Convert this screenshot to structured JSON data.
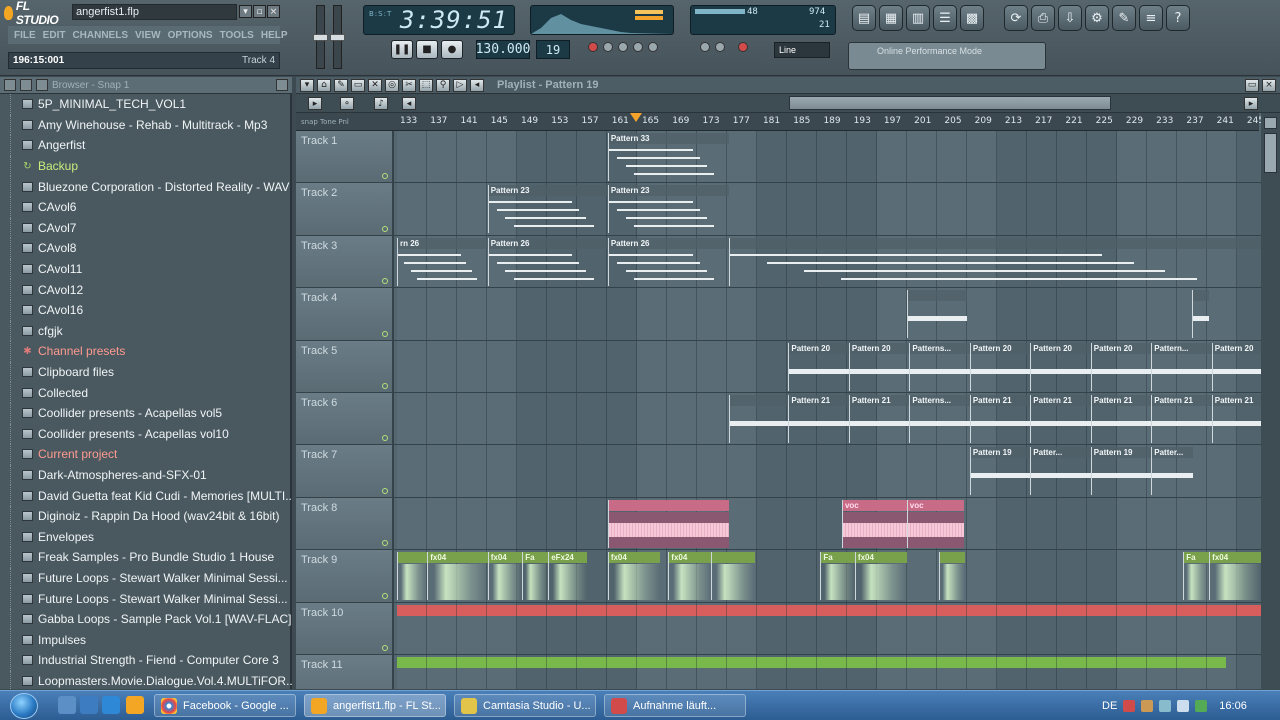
{
  "app": {
    "name": "FL STUDIO",
    "filename": "angerfist1.flp",
    "menu": [
      "FILE",
      "EDIT",
      "CHANNELS",
      "VIEW",
      "OPTIONS",
      "TOOLS",
      "HELP"
    ],
    "hint_position": "196:15:001",
    "hint_track": "Track 4",
    "clock": "3:39:51",
    "clock_unit": "B:S:T",
    "tempo": "130.000",
    "pattern_num": "19",
    "snap": "Line",
    "cpu_mem": "48",
    "cpu_poly": "974",
    "cpu_small": "21",
    "hint_box": "Online Performance Mode"
  },
  "colors": {
    "accent": "#f4a32b",
    "clip_pink": "#c86b87",
    "clip_green": "#79a04a",
    "auto_red": "#d85e5e",
    "auto_green": "#79b94c"
  },
  "browser": {
    "title": "Browser - Snap 1",
    "items": [
      {
        "label": "5P_MINIMAL_TECH_VOL1",
        "type": "folder"
      },
      {
        "label": "Amy Winehouse - Rehab - Multitrack - Mp3",
        "type": "folder"
      },
      {
        "label": "Angerfist",
        "type": "folder"
      },
      {
        "label": "Backup",
        "type": "special-green"
      },
      {
        "label": "Bluezone Corporation - Distorted Reality - WAV",
        "type": "folder"
      },
      {
        "label": "CAvol6",
        "type": "folder"
      },
      {
        "label": "CAvol7",
        "type": "folder"
      },
      {
        "label": "CAvol8",
        "type": "folder"
      },
      {
        "label": "CAvol11",
        "type": "folder"
      },
      {
        "label": "CAvol12",
        "type": "folder"
      },
      {
        "label": "CAvol16",
        "type": "folder"
      },
      {
        "label": "cfgjk",
        "type": "folder"
      },
      {
        "label": "Channel presets",
        "type": "special-red"
      },
      {
        "label": "Clipboard files",
        "type": "folder"
      },
      {
        "label": "Collected",
        "type": "folder"
      },
      {
        "label": "Coollider presents - Acapellas vol5",
        "type": "folder"
      },
      {
        "label": "Coollider presents - Acapellas vol10",
        "type": "folder"
      },
      {
        "label": "Current project",
        "type": "special-red"
      },
      {
        "label": "Dark-Atmospheres-and-SFX-01",
        "type": "folder"
      },
      {
        "label": "David Guetta feat Kid Cudi - Memories [MULTI...",
        "type": "folder"
      },
      {
        "label": "Diginoiz - Rappin Da Hood (wav24bit & 16bit)",
        "type": "folder"
      },
      {
        "label": "Envelopes",
        "type": "folder"
      },
      {
        "label": "Freak Samples - Pro Bundle Studio 1 House",
        "type": "folder"
      },
      {
        "label": "Future Loops - Stewart Walker Minimal Sessi...",
        "type": "folder"
      },
      {
        "label": "Future Loops - Stewart Walker Minimal Sessi...",
        "type": "folder"
      },
      {
        "label": "Gabba Loops - Sample Pack Vol.1 [WAV-FLAC]",
        "type": "folder"
      },
      {
        "label": "Impulses",
        "type": "folder"
      },
      {
        "label": "Industrial Strength - Fiend - Computer Core 3",
        "type": "folder"
      },
      {
        "label": "Loopmasters.Movie.Dialogue.Vol.4.MULTiFOR...",
        "type": "folder"
      }
    ]
  },
  "playlist": {
    "title": "Playlist - Pattern 19",
    "ruler": [
      "133",
      "137",
      "141",
      "145",
      "149",
      "153",
      "157",
      "161",
      "165",
      "169",
      "173",
      "177",
      "181",
      "185",
      "189",
      "193",
      "197",
      "201",
      "205",
      "209",
      "213",
      "217",
      "221",
      "225",
      "229",
      "233",
      "237",
      "241",
      "245"
    ],
    "ruler_left": "snap  Tone  Pnl",
    "tracks": [
      {
        "name": "Track 1",
        "clips": [
          {
            "label": "Pattern 33",
            "kind": "notes",
            "start": 0.244,
            "width": 0.14
          }
        ]
      },
      {
        "name": "Track 2",
        "clips": [
          {
            "label": "Pattern 23",
            "kind": "notes",
            "start": 0.105,
            "width": 0.139
          },
          {
            "label": "Pattern 23",
            "kind": "notes",
            "start": 0.244,
            "width": 0.14
          }
        ]
      },
      {
        "name": "Track 3",
        "clips": [
          {
            "label": "rn 26",
            "kind": "notes",
            "start": 0.0,
            "width": 0.105
          },
          {
            "label": "Pattern 26",
            "kind": "notes",
            "start": 0.105,
            "width": 0.139
          },
          {
            "label": "Pattern 26",
            "kind": "notes",
            "start": 0.244,
            "width": 0.14
          },
          {
            "label": "",
            "kind": "notes",
            "start": 0.384,
            "width": 0.616
          }
        ]
      },
      {
        "name": "Track 4",
        "clips": [
          {
            "label": "",
            "kind": "bar",
            "start": 0.59,
            "width": 0.07
          },
          {
            "label": "",
            "kind": "bar",
            "start": 0.92,
            "width": 0.02
          }
        ]
      },
      {
        "name": "Track 5",
        "clips": [
          {
            "label": "Pattern 20",
            "kind": "bar",
            "start": 0.453,
            "width": 0.07
          },
          {
            "label": "Pattern 20",
            "kind": "bar",
            "start": 0.523,
            "width": 0.07
          },
          {
            "label": "Patterns...",
            "kind": "bar",
            "start": 0.593,
            "width": 0.07
          },
          {
            "label": "Pattern 20",
            "kind": "bar",
            "start": 0.663,
            "width": 0.07
          },
          {
            "label": "Pattern 20",
            "kind": "bar",
            "start": 0.733,
            "width": 0.07
          },
          {
            "label": "Pattern 20",
            "kind": "bar",
            "start": 0.803,
            "width": 0.07
          },
          {
            "label": "Pattern...",
            "kind": "bar",
            "start": 0.873,
            "width": 0.07
          },
          {
            "label": "Pattern 20",
            "kind": "bar",
            "start": 0.943,
            "width": 0.057
          }
        ]
      },
      {
        "name": "Track 6",
        "clips": [
          {
            "label": "",
            "kind": "bar",
            "start": 0.384,
            "width": 0.069
          },
          {
            "label": "Pattern 21",
            "kind": "bar",
            "start": 0.453,
            "width": 0.07
          },
          {
            "label": "Pattern 21",
            "kind": "bar",
            "start": 0.523,
            "width": 0.07
          },
          {
            "label": "Patterns...",
            "kind": "bar",
            "start": 0.593,
            "width": 0.07
          },
          {
            "label": "Pattern 21",
            "kind": "bar",
            "start": 0.663,
            "width": 0.07
          },
          {
            "label": "Pattern 21",
            "kind": "bar",
            "start": 0.733,
            "width": 0.07
          },
          {
            "label": "Pattern 21",
            "kind": "bar",
            "start": 0.803,
            "width": 0.07
          },
          {
            "label": "Pattern 21",
            "kind": "bar",
            "start": 0.873,
            "width": 0.07
          },
          {
            "label": "Pattern 21",
            "kind": "bar",
            "start": 0.943,
            "width": 0.057
          }
        ]
      },
      {
        "name": "Track 7",
        "clips": [
          {
            "label": "Pattern 19",
            "kind": "bar",
            "start": 0.663,
            "width": 0.07
          },
          {
            "label": "Patter...",
            "kind": "bar",
            "start": 0.733,
            "width": 0.07
          },
          {
            "label": "Pattern 19",
            "kind": "bar",
            "start": 0.803,
            "width": 0.07
          },
          {
            "label": "Patter...",
            "kind": "bar",
            "start": 0.873,
            "width": 0.048
          }
        ]
      },
      {
        "name": "Track 8",
        "clips": [
          {
            "label": "",
            "kind": "audio-pink",
            "start": 0.244,
            "width": 0.14
          },
          {
            "label": "voc",
            "kind": "audio-pink",
            "start": 0.515,
            "width": 0.075
          },
          {
            "label": "voc",
            "kind": "audio-pink",
            "start": 0.59,
            "width": 0.066
          }
        ]
      },
      {
        "name": "Track 9",
        "clips": [
          {
            "label": "",
            "kind": "audio-green",
            "start": 0.0,
            "width": 0.035
          },
          {
            "label": "fx04",
            "kind": "audio-green",
            "start": 0.035,
            "width": 0.07
          },
          {
            "label": "fx04",
            "kind": "audio-green",
            "start": 0.105,
            "width": 0.04
          },
          {
            "label": "Fa",
            "kind": "audio-green",
            "start": 0.145,
            "width": 0.03
          },
          {
            "label": "eFx24",
            "kind": "audio-green",
            "start": 0.175,
            "width": 0.045
          },
          {
            "label": "fx04",
            "kind": "audio-green",
            "start": 0.244,
            "width": 0.06
          },
          {
            "label": "fx04",
            "kind": "audio-green",
            "start": 0.314,
            "width": 0.05
          },
          {
            "label": "",
            "kind": "audio-green",
            "start": 0.364,
            "width": 0.05
          },
          {
            "label": "Fa",
            "kind": "audio-green",
            "start": 0.49,
            "width": 0.04
          },
          {
            "label": "fx04",
            "kind": "audio-green",
            "start": 0.53,
            "width": 0.06
          },
          {
            "label": "",
            "kind": "audio-green",
            "start": 0.627,
            "width": 0.03
          },
          {
            "label": "Fa",
            "kind": "audio-green",
            "start": 0.91,
            "width": 0.03
          },
          {
            "label": "fx04",
            "kind": "audio-green",
            "start": 0.94,
            "width": 0.06
          }
        ]
      },
      {
        "name": "Track 10",
        "clips": [
          {
            "label": "",
            "kind": "auto-red",
            "start": 0.0,
            "width": 1.0
          }
        ]
      },
      {
        "name": "Track 11",
        "clips": [
          {
            "label": "",
            "kind": "auto-green",
            "start": 0.0,
            "width": 0.96
          }
        ]
      }
    ]
  },
  "taskbar": {
    "tasks": [
      "Facebook - Google ...",
      "angerfist1.flp - FL St...",
      "Camtasia Studio - U...",
      "Aufnahme läuft..."
    ],
    "lang": "DE",
    "time": "16:06"
  }
}
